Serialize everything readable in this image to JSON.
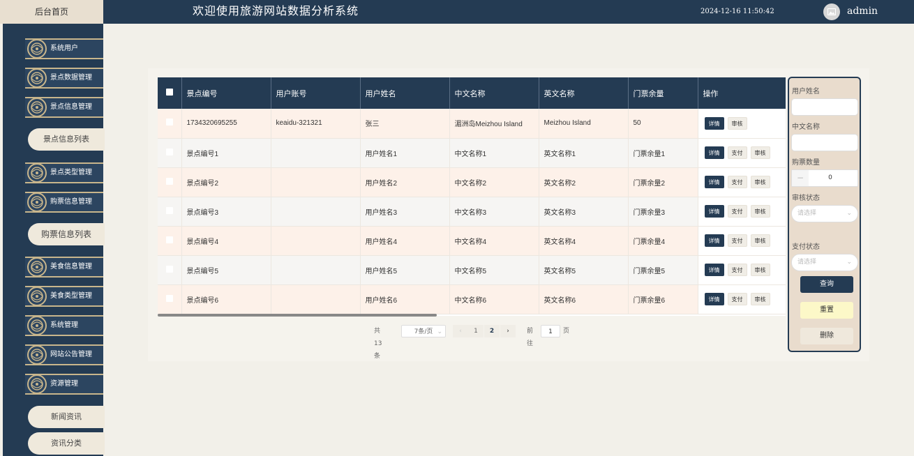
{
  "header": {
    "home_tab": "后台首页",
    "title": "欢迎使用旅游网站数据分析系统",
    "datetime": "2024-12-16 11:50:42",
    "username": "admin"
  },
  "sidebar": {
    "items": [
      {
        "label": "系统用户",
        "type": "menu"
      },
      {
        "label": "景点数据管理",
        "type": "menu"
      },
      {
        "label": "景点信息管理",
        "type": "menu"
      },
      {
        "label": "景点信息列表",
        "type": "sub"
      },
      {
        "label": "景点类型管理",
        "type": "menu"
      },
      {
        "label": "购票信息管理",
        "type": "menu"
      },
      {
        "label": "购票信息列表",
        "type": "sub"
      },
      {
        "label": "美食信息管理",
        "type": "menu"
      },
      {
        "label": "美食类型管理",
        "type": "menu"
      },
      {
        "label": "系统管理",
        "type": "menu"
      },
      {
        "label": "网站公告管理",
        "type": "menu"
      },
      {
        "label": "资源管理",
        "type": "menu"
      },
      {
        "label": "新闻资讯",
        "type": "sub"
      },
      {
        "label": "资讯分类",
        "type": "sub"
      }
    ]
  },
  "table": {
    "headers": [
      "景点编号",
      "用户账号",
      "用户姓名",
      "中文名称",
      "英文名称",
      "门票余量",
      "操作"
    ],
    "rows": [
      {
        "c1": "1734320695255",
        "c2": "keaidu-321321",
        "c3": "张三",
        "c4": "湄洲岛Meizhou Island",
        "c5": "Meizhou Island",
        "c6": "50",
        "actions": [
          "详情",
          "审核"
        ]
      },
      {
        "c1": "景点编号1",
        "c2": "",
        "c3": "用户姓名1",
        "c4": "中文名称1",
        "c5": "英文名称1",
        "c6": "门票余量1",
        "actions": [
          "详情",
          "支付",
          "审核"
        ]
      },
      {
        "c1": "景点编号2",
        "c2": "",
        "c3": "用户姓名2",
        "c4": "中文名称2",
        "c5": "英文名称2",
        "c6": "门票余量2",
        "actions": [
          "详情",
          "支付",
          "审核"
        ]
      },
      {
        "c1": "景点编号3",
        "c2": "",
        "c3": "用户姓名3",
        "c4": "中文名称3",
        "c5": "英文名称3",
        "c6": "门票余量3",
        "actions": [
          "详情",
          "支付",
          "审核"
        ]
      },
      {
        "c1": "景点编号4",
        "c2": "",
        "c3": "用户姓名4",
        "c4": "中文名称4",
        "c5": "英文名称4",
        "c6": "门票余量4",
        "actions": [
          "详情",
          "支付",
          "审核"
        ]
      },
      {
        "c1": "景点编号5",
        "c2": "",
        "c3": "用户姓名5",
        "c4": "中文名称5",
        "c5": "英文名称5",
        "c6": "门票余量5",
        "actions": [
          "详情",
          "支付",
          "审核"
        ]
      },
      {
        "c1": "景点编号6",
        "c2": "",
        "c3": "用户姓名6",
        "c4": "中文名称6",
        "c5": "英文名称6",
        "c6": "门票余量6",
        "actions": [
          "详情",
          "支付",
          "审核"
        ]
      }
    ]
  },
  "pagination": {
    "total": "共 13 条",
    "page_size": "7条/页",
    "pages": [
      "1",
      "2"
    ],
    "current_page": "2",
    "goto_label": "前往",
    "goto_value": "1",
    "page_suffix": "页"
  },
  "filter": {
    "username_label": "用户姓名",
    "cn_name_label": "中文名称",
    "quantity_label": "购票数量",
    "quantity_value": "0",
    "audit_label": "审核状态",
    "audit_placeholder": "请选择",
    "pay_label": "支付状态",
    "pay_placeholder": "请选择",
    "query": "查询",
    "reset": "重置",
    "delete": "删除"
  },
  "colors": {
    "primary": "#243b53",
    "accent_gold": "#c9b68c",
    "row_tint": "#fdf1e9",
    "reset_button": "#fcf8c8"
  },
  "icons": [
    "avatar-image-icon",
    "ornament-icon",
    "chevron-left-icon",
    "chevron-right-icon",
    "chevron-down-icon",
    "checkbox-icon"
  ]
}
